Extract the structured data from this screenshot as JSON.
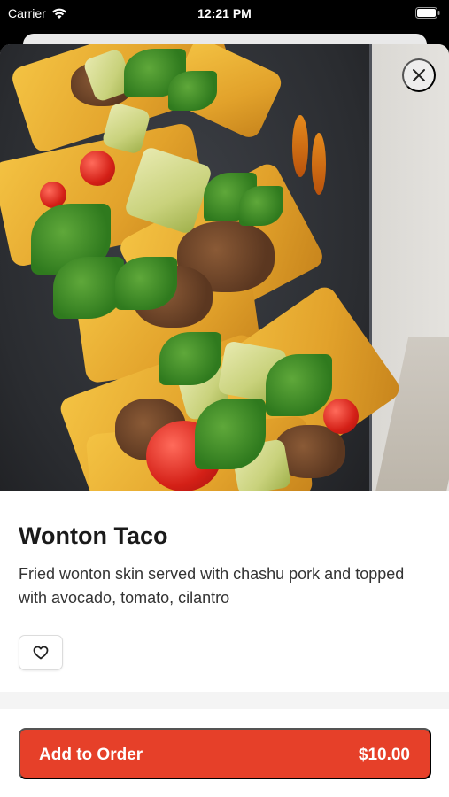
{
  "status_bar": {
    "carrier": "Carrier",
    "time": "12:21 PM"
  },
  "item": {
    "name": "Wonton Taco",
    "description": "Fried wonton skin served with chashu pork and topped with avocado, tomato, cilantro"
  },
  "actions": {
    "add_to_order_label": "Add to Order",
    "price": "$10.00"
  },
  "colors": {
    "accent": "#e64029",
    "title_text": "#1a1a1a"
  },
  "icons": {
    "close": "close-icon",
    "favorite": "heart-icon",
    "wifi": "wifi-icon",
    "battery": "battery-icon"
  }
}
